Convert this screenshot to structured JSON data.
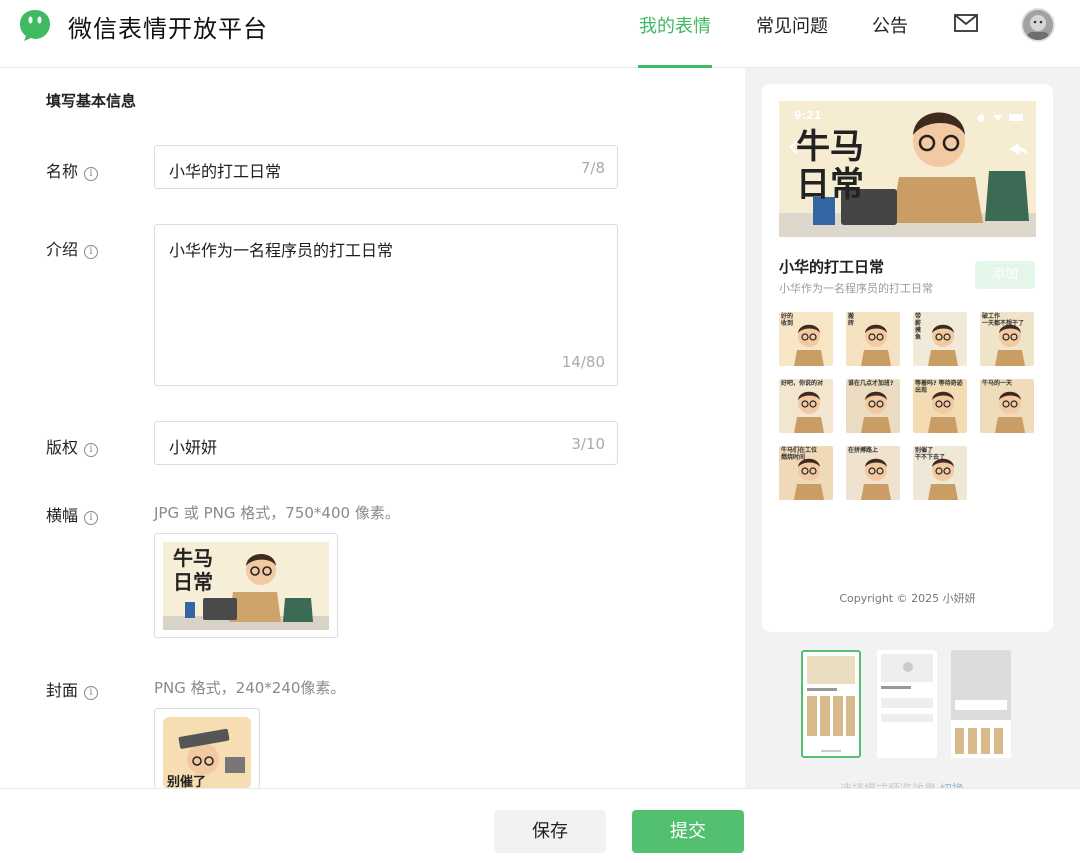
{
  "header": {
    "brand": "微信表情开放平台",
    "nav": [
      "我的表情",
      "常见问题",
      "公告"
    ],
    "mail_icon": "mail-icon",
    "avatar_icon": "avatar"
  },
  "form": {
    "section_title": "填写基本信息",
    "name": {
      "label": "名称",
      "value": "小华的打工日常",
      "count": "7/8"
    },
    "intro": {
      "label": "介绍",
      "value": "小华作为一名程序员的打工日常",
      "count": "14/80"
    },
    "copyright": {
      "label": "版权",
      "value": "小妍妍",
      "count": "3/10"
    },
    "banner": {
      "label": "横幅",
      "hint": "JPG 或 PNG 格式，750*400 像素。",
      "art_text": [
        "牛马",
        "日常"
      ]
    },
    "cover": {
      "label": "封面",
      "hint": "PNG 格式，240*240像素。",
      "art_text": "别催了"
    }
  },
  "preview": {
    "status_time": "9:21",
    "banner_text": [
      "牛马",
      "日常"
    ],
    "title": "小华的打工日常",
    "subtitle": "小华作为一名程序员的打工日常",
    "add_label": "添加",
    "stickers": [
      {
        "captions": [
          "好的",
          "收到"
        ],
        "bg": "#f7e7c6"
      },
      {
        "captions": [
          "搬",
          "砖"
        ],
        "bg": "#f4e2c0"
      },
      {
        "captions": [
          "带",
          "薪",
          "摸",
          "鱼"
        ],
        "bg": "#f1ead8"
      },
      {
        "captions": [
          "破工作",
          "一天都不想干了"
        ],
        "bg": "#f0e4c8"
      },
      {
        "captions": [
          "好吧，你说的对"
        ],
        "bg": "#f2e6cf"
      },
      {
        "captions": [
          "谁在几点才加班?"
        ],
        "bg": "#ecdcc2"
      },
      {
        "captions": [
          "等着吗? 等待奇迹出现"
        ],
        "bg": "#f3dbb4"
      },
      {
        "captions": [
          "牛马的一天"
        ],
        "bg": "#eedcbd"
      },
      {
        "captions": [
          "牛马们在工位",
          "燃烧时间"
        ],
        "bg": "#f0d9b7"
      },
      {
        "captions": [
          "在拼搏路上"
        ],
        "bg": "#efe3cf"
      },
      {
        "captions": [
          "别催了",
          "干不下去了"
        ],
        "bg": "#efe8d6"
      }
    ],
    "copyright": "Copyright © 2025 小妍妍",
    "thumb_hint": "选择模式预览效果",
    "thumb_hint_link": "切换"
  },
  "actions": {
    "save": "保存",
    "submit": "提交"
  },
  "colors": {
    "accent": "#3fb962",
    "submit": "#52c06f",
    "panel": "#f2f2f2"
  }
}
